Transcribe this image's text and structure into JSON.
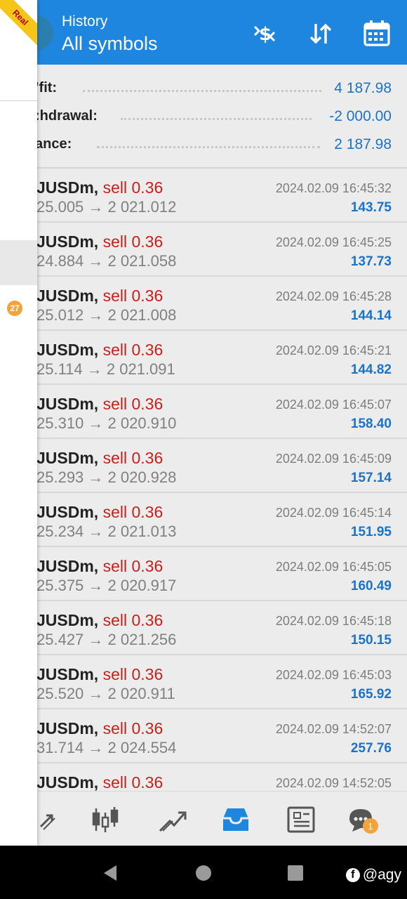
{
  "header": {
    "title_small": "History",
    "title_big": "All symbols",
    "icons": [
      "dollar-exchange-icon",
      "sort-icon",
      "calendar-icon"
    ]
  },
  "summary": {
    "rows": [
      {
        "label": "’fit:",
        "value": "4 187.98"
      },
      {
        "label": ":hdrawal:",
        "value": "-2 000.00"
      },
      {
        "label": "ance:",
        "value": "2 187.98"
      }
    ]
  },
  "deals": [
    {
      "symbol": "JUSDm,",
      "side": "sell 0.36",
      "prices": "25.005 → 2 021.012",
      "time": "2024.02.09 16:45:32",
      "profit": "143.75"
    },
    {
      "symbol": "JUSDm,",
      "side": "sell 0.36",
      "prices": "24.884 → 2 021.058",
      "time": "2024.02.09 16:45:25",
      "profit": "137.73"
    },
    {
      "symbol": "JUSDm,",
      "side": "sell 0.36",
      "prices": "25.012 → 2 021.008",
      "time": "2024.02.09 16:45:28",
      "profit": "144.14"
    },
    {
      "symbol": "JUSDm,",
      "side": "sell 0.36",
      "prices": "25.114 → 2 021.091",
      "time": "2024.02.09 16:45:21",
      "profit": "144.82"
    },
    {
      "symbol": "JUSDm,",
      "side": "sell 0.36",
      "prices": "25.310 → 2 020.910",
      "time": "2024.02.09 16:45:07",
      "profit": "158.40"
    },
    {
      "symbol": "JUSDm,",
      "side": "sell 0.36",
      "prices": "25.293 → 2 020.928",
      "time": "2024.02.09 16:45:09",
      "profit": "157.14"
    },
    {
      "symbol": "JUSDm,",
      "side": "sell 0.36",
      "prices": "25.234 → 2 021.013",
      "time": "2024.02.09 16:45:14",
      "profit": "151.95"
    },
    {
      "symbol": "JUSDm,",
      "side": "sell 0.36",
      "prices": "25.375 → 2 020.917",
      "time": "2024.02.09 16:45:05",
      "profit": "160.49"
    },
    {
      "symbol": "JUSDm,",
      "side": "sell 0.36",
      "prices": "25.427 → 2 021.256",
      "time": "2024.02.09 16:45:18",
      "profit": "150.15"
    },
    {
      "symbol": "JUSDm,",
      "side": "sell 0.36",
      "prices": "25.520 → 2 020.911",
      "time": "2024.02.09 16:45:03",
      "profit": "165.92"
    },
    {
      "symbol": "JUSDm,",
      "side": "sell 0.36",
      "prices": "31.714 → 2 024.554",
      "time": "2024.02.09 14:52:07",
      "profit": "257.76"
    },
    {
      "symbol": "JUSDm,",
      "side": "sell 0.36",
      "prices": "",
      "time": "2024.02.09 14:52:05",
      "profit": ""
    }
  ],
  "bottom_nav": {
    "items": [
      "quotes-icon",
      "chart-candles-icon",
      "trade-icon",
      "history-inbox-icon",
      "news-icon",
      "chat-icon"
    ],
    "active": "history-inbox-icon",
    "chat_badge": "1"
  },
  "drawer": {
    "ribbon": "Real",
    "badge": "27"
  },
  "android_nav": {
    "watermark": "@agy"
  },
  "colors": {
    "header_blue": "#1f86e0",
    "profit_blue": "#1b73c7",
    "sell_red": "#c8201b",
    "badge_orange": "#f2a33a"
  }
}
